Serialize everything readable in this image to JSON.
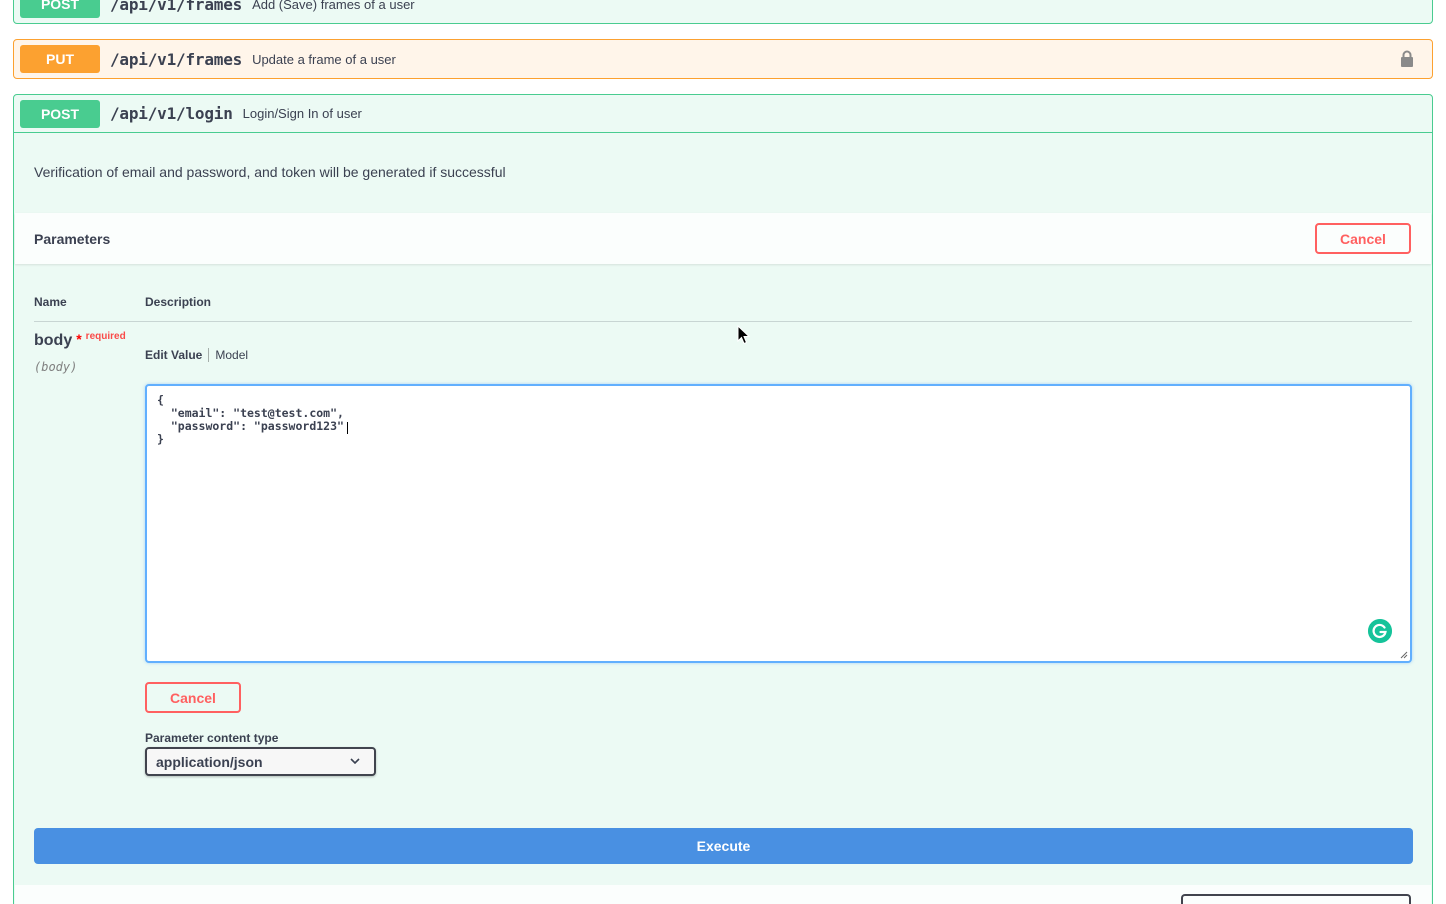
{
  "endpoints": {
    "post_frames": {
      "method": "POST",
      "path": "/api/v1/frames",
      "summary": "Add (Save) frames of a user"
    },
    "put_frames": {
      "method": "PUT",
      "path": "/api/v1/frames",
      "summary": "Update a frame of a user"
    },
    "post_login": {
      "method": "POST",
      "path": "/api/v1/login",
      "summary": "Login/Sign In of user"
    }
  },
  "login": {
    "description": "Verification of email and password, and token will be generated if successful",
    "parameters_title": "Parameters",
    "cancel_label": "Cancel",
    "columns": {
      "name": "Name",
      "description": "Description"
    },
    "param": {
      "name": "body",
      "required_star": "*",
      "required_label": "required",
      "in": "(body)"
    },
    "tabs": {
      "edit_value": "Edit Value",
      "model": "Model"
    },
    "body_value": "{\n  \"email\": \"test@test.com\",\n  \"password\": \"password123\"\n}",
    "editor_cancel_label": "Cancel",
    "content_type_label": "Parameter content type",
    "content_type_value": "application/json",
    "execute_label": "Execute"
  },
  "colors": {
    "post": "#49cc90",
    "put": "#fca130",
    "execute": "#4990e2",
    "cancel": "#ff6060"
  }
}
